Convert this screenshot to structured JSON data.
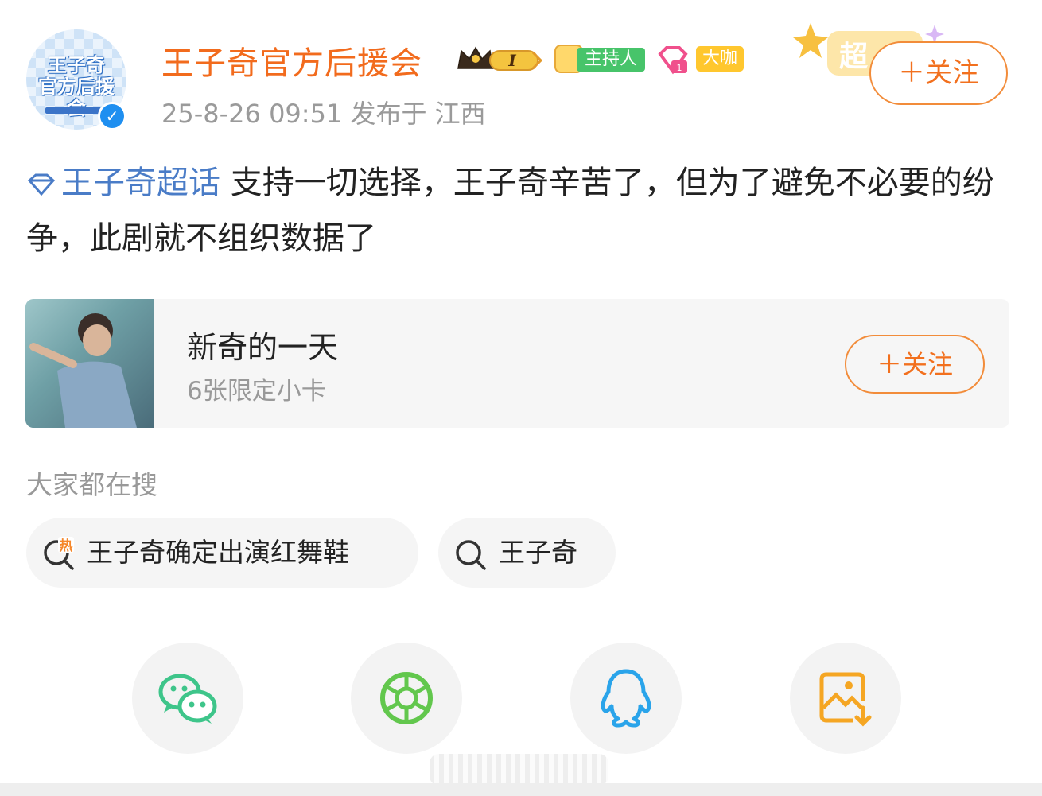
{
  "header": {
    "avatar_text_line1": "王子奇",
    "avatar_text_line2": "官方后援会",
    "username": "王子奇官方后援会",
    "crown_badge_level": "I",
    "host_badge": "主持人",
    "daka_badge": "大咖",
    "chao_deco_text": "超",
    "timestamp": "25-8-26 09:51",
    "location": "发布于 江西",
    "follow_label": "＋关注"
  },
  "post": {
    "topic": "王子奇超话",
    "text": " 支持一切选择，王子奇辛苦了，但为了避免不必要的纷争，此剧就不组织数据了"
  },
  "card": {
    "title": "新奇的一天",
    "subtitle": "6张限定小卡",
    "follow_label": "＋关注"
  },
  "search": {
    "title": "大家都在搜",
    "chips": [
      {
        "label": "王子奇确定出演红舞鞋",
        "icon": "hot-search-icon"
      },
      {
        "label": "王子奇",
        "icon": "search-icon"
      }
    ]
  },
  "share": [
    {
      "icon": "wechat-icon",
      "color": "#3ec58a"
    },
    {
      "icon": "moments-icon",
      "color": "#62c74d"
    },
    {
      "icon": "qq-icon",
      "color": "#2aa4ea"
    },
    {
      "icon": "save-image-icon",
      "color": "#f5a623"
    }
  ],
  "colors": {
    "username": "#f26b1d",
    "topic": "#4a7cc7",
    "follow": "#f2701e"
  }
}
